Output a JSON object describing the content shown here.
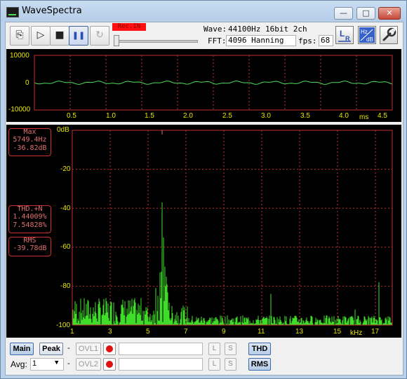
{
  "window": {
    "title": "WaveSpectra",
    "minimize": "—",
    "maximize": "□",
    "close": "✕"
  },
  "toolbar": {
    "rec_indicator": "Rec.IN",
    "wave_label": "Wave:",
    "wave_value": "44100Hz 16bit 2ch",
    "fft_label": "FFT:",
    "fft_value": "4096 Hanning",
    "fps_label": "fps:",
    "fps_value": "68",
    "buttons": [
      {
        "name": "open-icon",
        "glyph": "⎘"
      },
      {
        "name": "play-icon",
        "glyph": "▷"
      },
      {
        "name": "stop-icon",
        "glyph": "■"
      },
      {
        "name": "pause-icon",
        "glyph": "❚❚"
      },
      {
        "name": "repeat-icon",
        "glyph": "↻"
      }
    ]
  },
  "waveform": {
    "y_ticks": [
      "10000",
      "0",
      "-10000"
    ],
    "x_ticks": [
      "0.5",
      "1.0",
      "1.5",
      "2.0",
      "2.5",
      "3.0",
      "3.5",
      "4.0",
      "4.5"
    ],
    "x_unit": "ms",
    "trace_color": "#4fdc5b",
    "axis_color": "#e8e800",
    "grid_color": "#c03030"
  },
  "spectrum": {
    "y_ticks": [
      "0dB",
      "-20",
      "-40",
      "-60",
      "-80",
      "-100"
    ],
    "x_ticks": [
      "1",
      "3",
      "5",
      "7",
      "9",
      "11",
      "13",
      "15",
      "17"
    ],
    "x_unit": "kHz",
    "max_box": {
      "title": "Max",
      "freq": "5749.4Hz",
      "level": "-36.82dB"
    },
    "thd_box": {
      "title": "THD.+N",
      "v1": "1.44009%",
      "v2": "7.54828%"
    },
    "rms_box": {
      "title": "RMS",
      "v1": "-39.78dB"
    },
    "bar_color": "#3fdc2a"
  },
  "bottom": {
    "main": "Main",
    "peak": "Peak",
    "avg_label": "Avg:",
    "avg_value": "1",
    "dash": "-",
    "ovl1": "OVL1",
    "ovl2": "OVL2",
    "l": "L",
    "s": "S",
    "thd": "THD",
    "rms": "RMS"
  }
}
